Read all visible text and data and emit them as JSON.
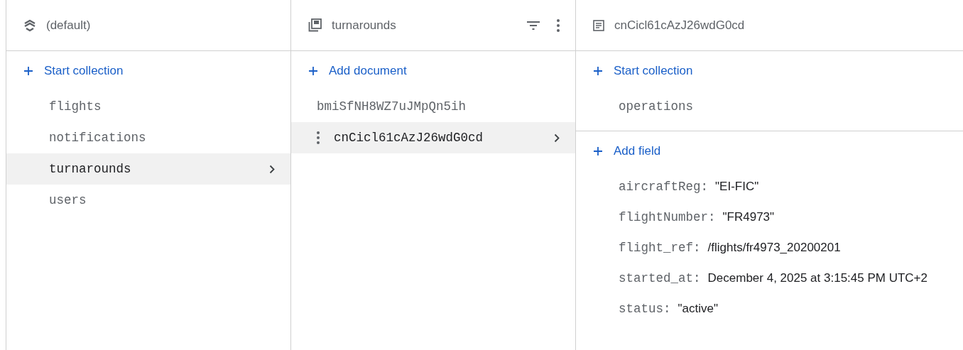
{
  "database": {
    "name": "(default)"
  },
  "collections_panel": {
    "action": "Start collection",
    "items": [
      {
        "name": "flights",
        "selected": false
      },
      {
        "name": "notifications",
        "selected": false
      },
      {
        "name": "turnarounds",
        "selected": true
      },
      {
        "name": "users",
        "selected": false
      }
    ]
  },
  "documents_panel": {
    "title": "turnarounds",
    "action": "Add document",
    "items": [
      {
        "name": "bmiSfNH8WZ7uJMpQn5ih",
        "selected": false
      },
      {
        "name": "cnCicl61cAzJ26wdG0cd",
        "selected": true
      }
    ]
  },
  "document_panel": {
    "title": "cnCicl61cAzJ26wdG0cd",
    "collections_action": "Start collection",
    "subcollections": [
      "operations"
    ],
    "fields_action": "Add field",
    "fields": [
      {
        "key": "aircraftReg:",
        "value": "\"EI-FIC\""
      },
      {
        "key": "flightNumber:",
        "value": "\"FR4973\""
      },
      {
        "key": "flight_ref:",
        "value": "/flights/fr4973_20200201"
      },
      {
        "key": "started_at:",
        "value": "December 4, 2025 at 3:15:45 PM UTC+2"
      },
      {
        "key": "status:",
        "value": "\"active\""
      }
    ]
  }
}
